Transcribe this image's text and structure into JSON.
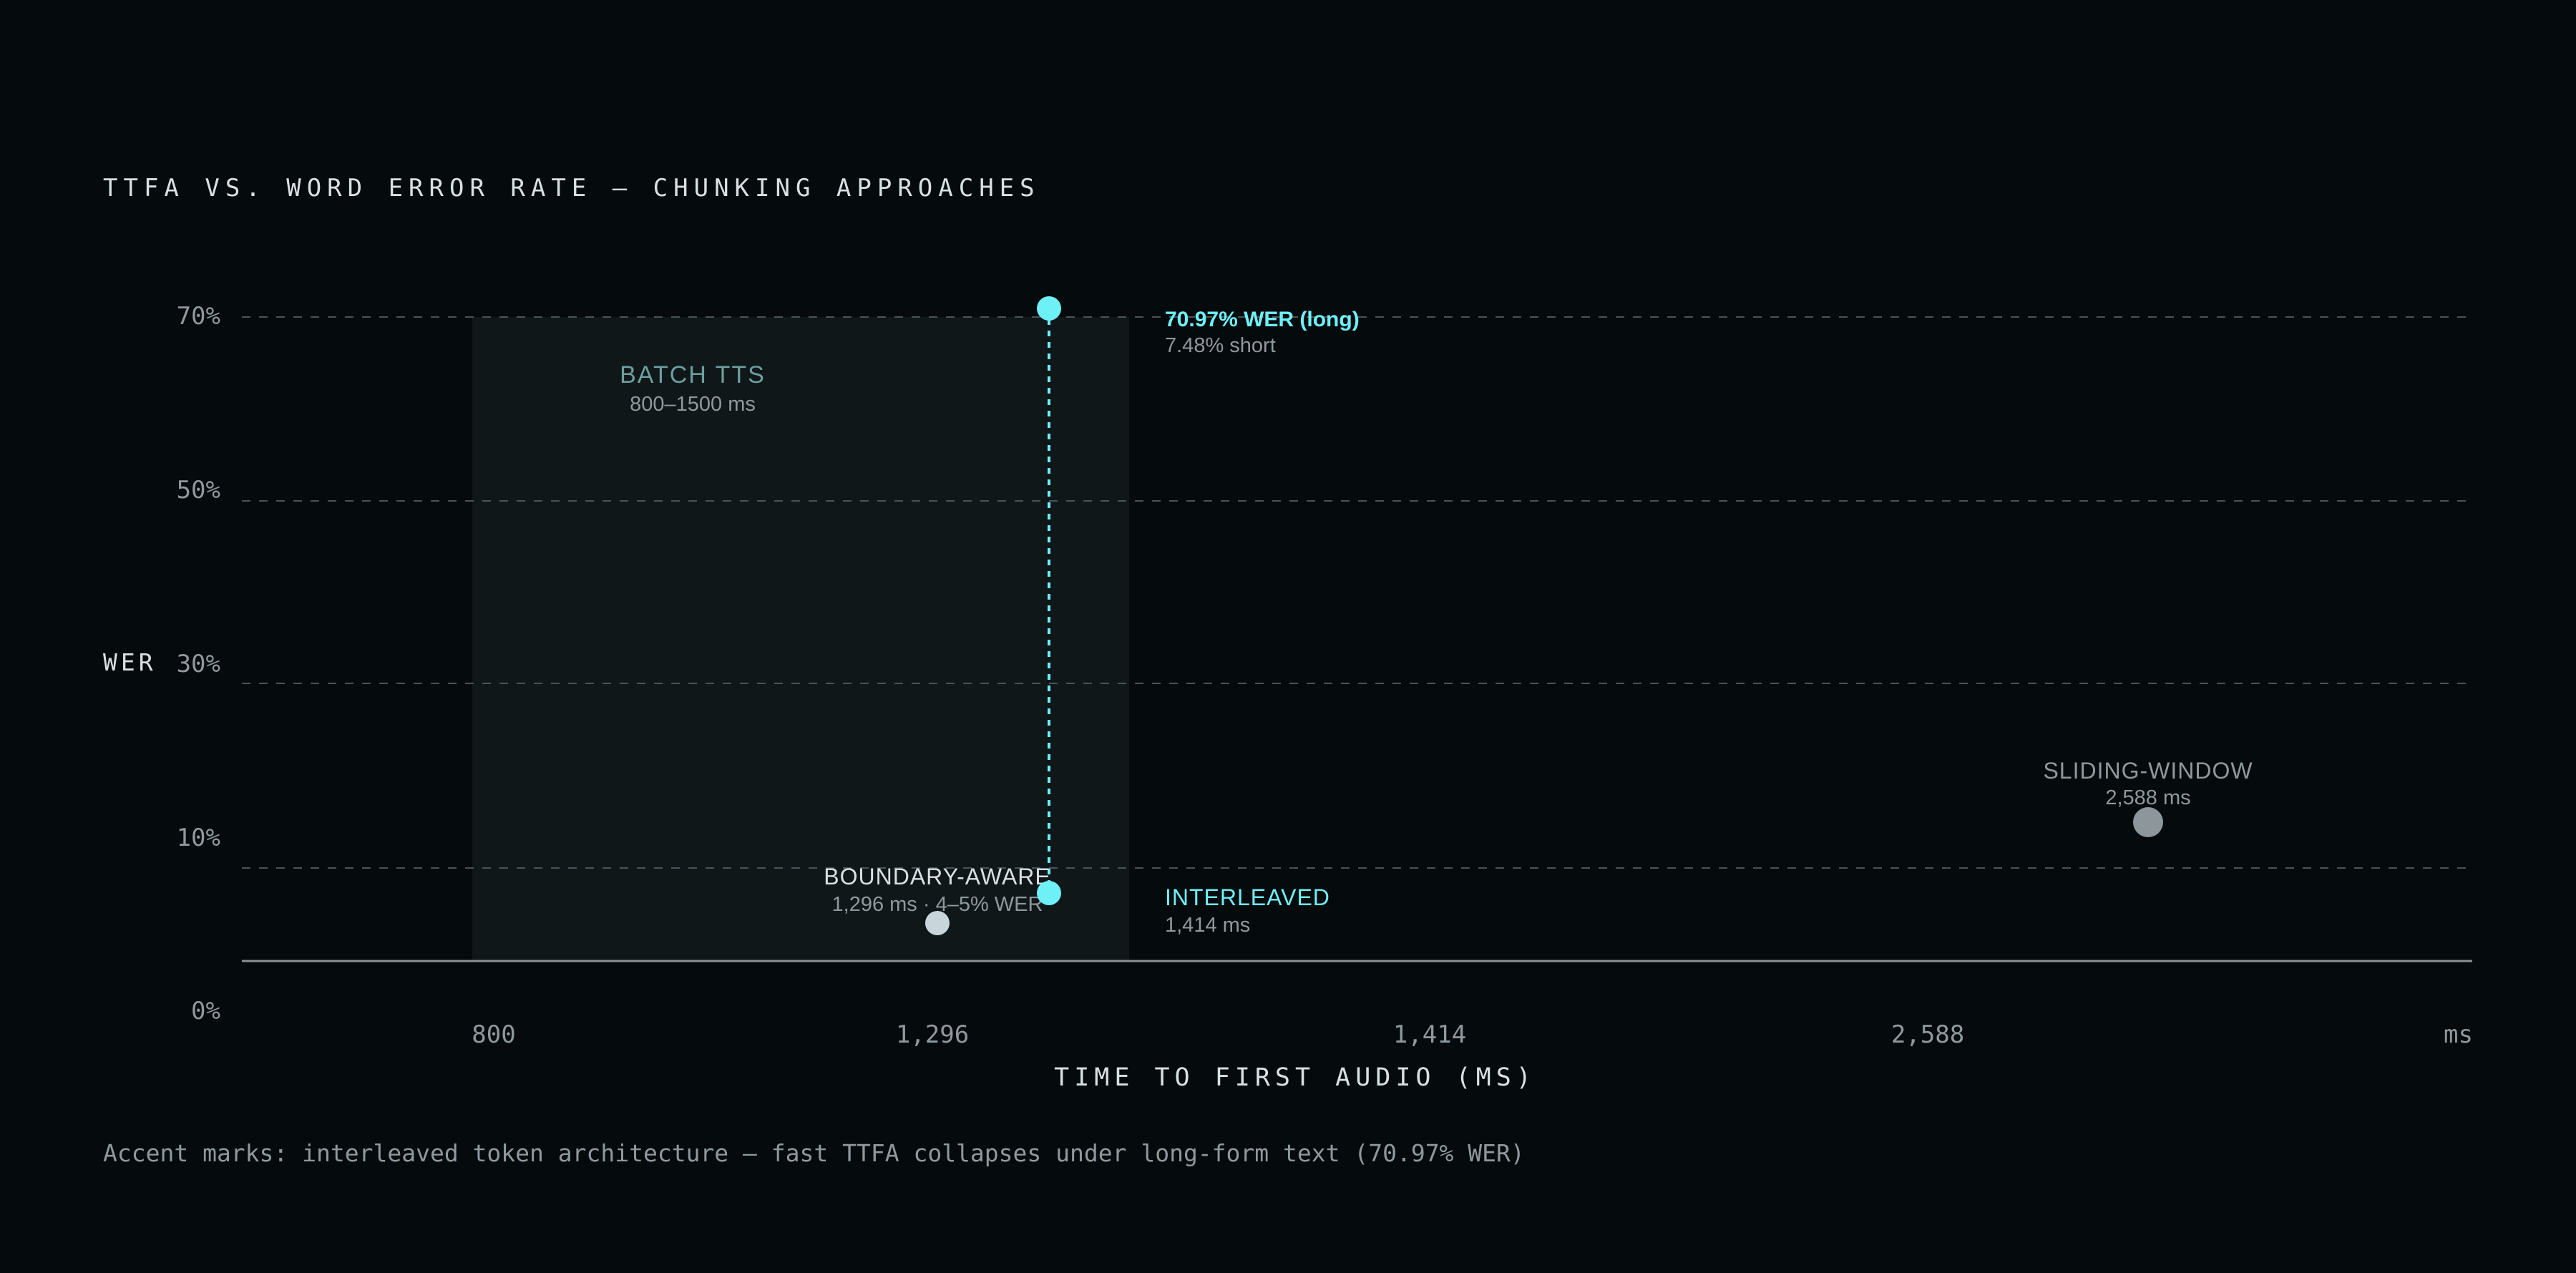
{
  "chart_data": {
    "type": "scatter",
    "title": "TTFA VS. WORD ERROR RATE — CHUNKING APPROACHES",
    "xlabel": "TIME TO FIRST AUDIO (MS)",
    "ylabel": "WER",
    "x_unit_label": "ms",
    "x_ticks": [
      "800",
      "1,296",
      "1,414",
      "2,588"
    ],
    "y_ticks": [
      "0%",
      "10%",
      "30%",
      "50%",
      "70%"
    ],
    "grid": true,
    "shaded_band": {
      "label": "BATCH TTS",
      "sublabel": "800–1500 ms",
      "x_start": 800,
      "x_end": 1500
    },
    "points": [
      {
        "name": "BOUNDARY-AWARE",
        "detail": "1,296 ms · 4–5% WER",
        "x": 1296,
        "y": 4.5,
        "color": "#c8d6dc"
      },
      {
        "name": "INTERLEAVED",
        "detail": "1,414 ms",
        "x": 1414,
        "y": 7.48,
        "color": "#6ef0f7"
      },
      {
        "name": "SLIDING-WINDOW",
        "detail": "2,588 ms",
        "x": 2588,
        "y": 15,
        "color": "#8d979b"
      }
    ],
    "highlight": {
      "x": 1414,
      "y_long": 70.97,
      "y_short": 7.48,
      "label": "70.97% WER (long)",
      "sublabel": "7.48% short",
      "color": "#6ef0f7"
    }
  },
  "footnote": "Accent marks: interleaved token architecture — fast TTFA collapses under long-form text (70.97% WER)",
  "colors": {
    "background": "#050a0c",
    "accent": "#6ef0f7",
    "grid": "#4a5357",
    "band": "#0f1719",
    "text_primary": "#d7e0e3",
    "text_muted": "#8f999d"
  }
}
